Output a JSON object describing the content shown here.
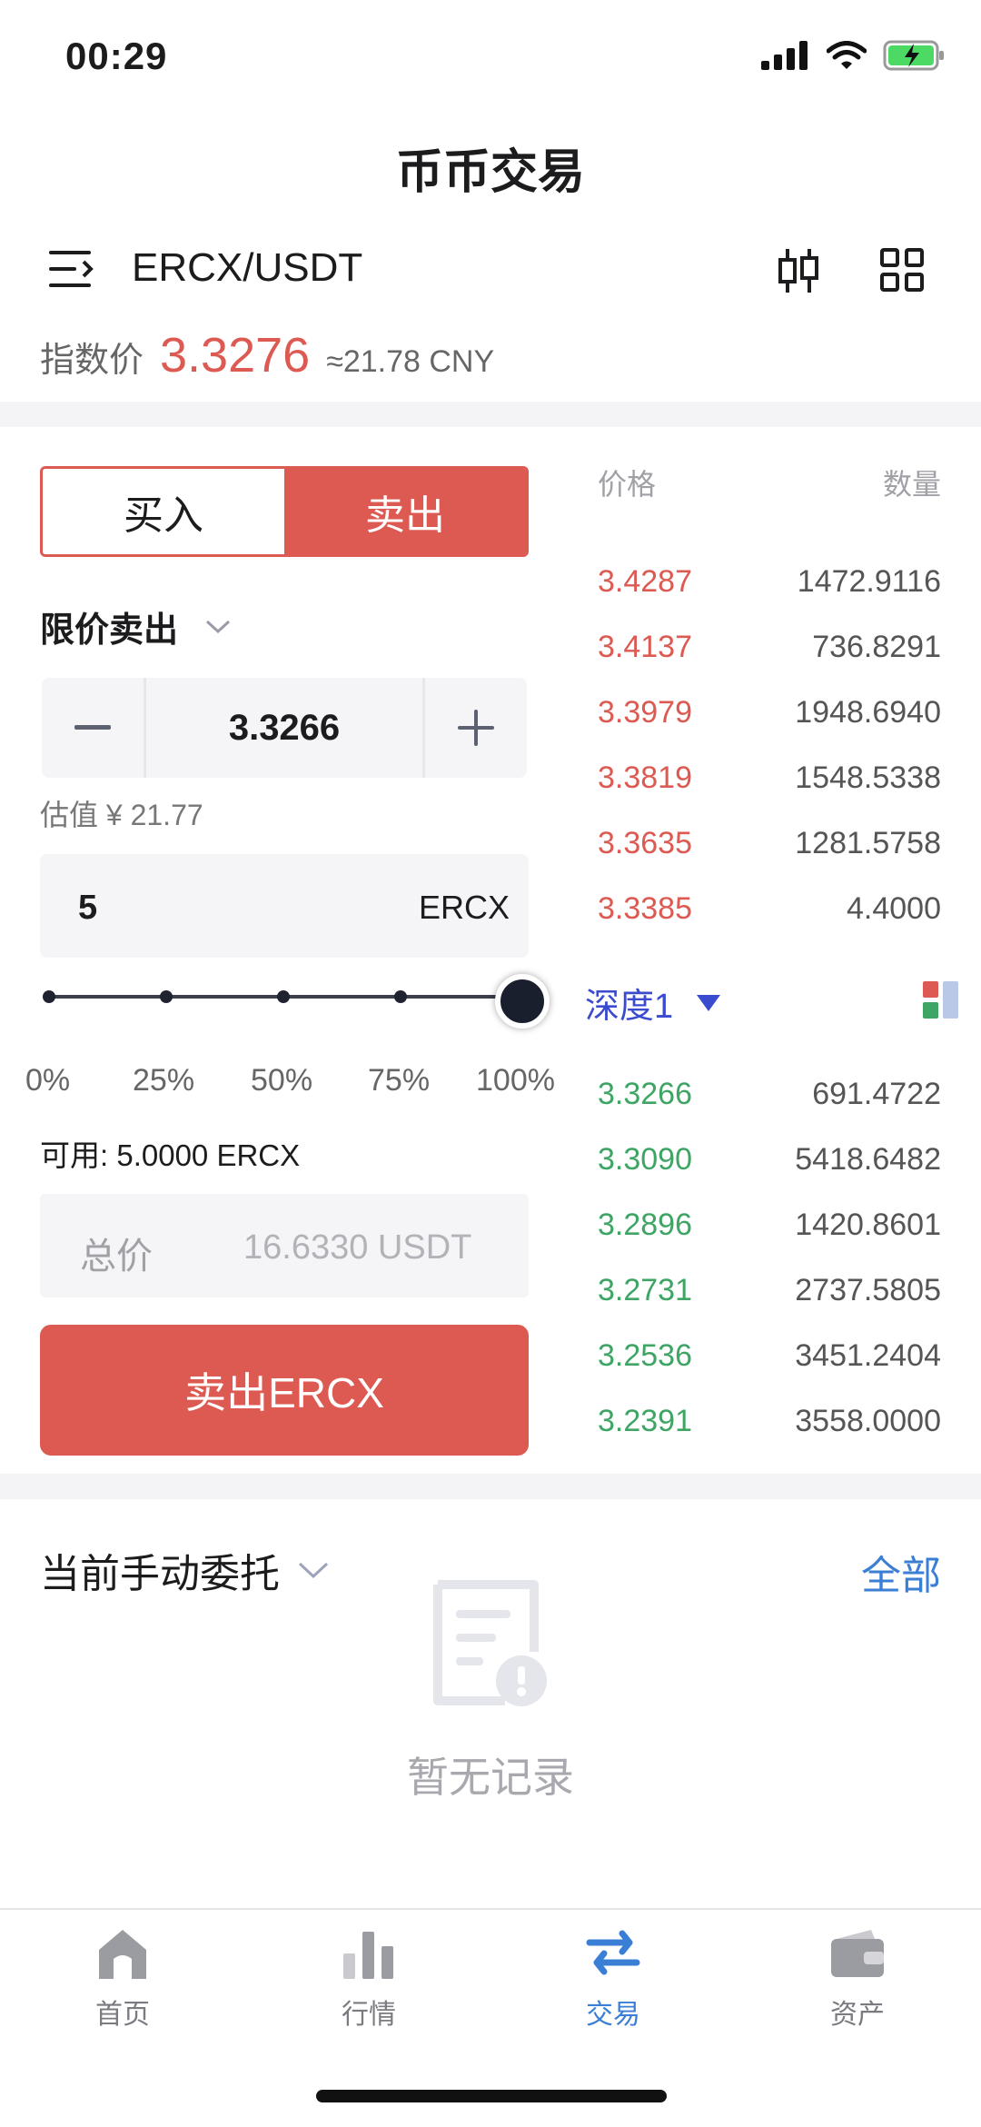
{
  "status": {
    "time": "00:29"
  },
  "header": {
    "title": "币币交易",
    "pair": "ERCX/USDT"
  },
  "index": {
    "label": "指数价",
    "price": "3.3276",
    "cny": "≈21.78 CNY"
  },
  "trade": {
    "buy_label": "买入",
    "sell_label": "卖出",
    "order_type": "限价卖出",
    "price": "3.3266",
    "estimate": "估值 ¥ 21.77",
    "quantity": "5",
    "quantity_unit": "ERCX",
    "slider_percent": 100,
    "percents": [
      "0%",
      "25%",
      "50%",
      "75%",
      "100%"
    ],
    "available": "可用:  5.0000 ERCX",
    "total_label": "总价",
    "total_value": "16.6330 USDT",
    "submit_label": "卖出ERCX"
  },
  "orderbook": {
    "price_header": "价格",
    "qty_header": "数量",
    "asks": [
      {
        "price": "3.4287",
        "qty": "1472.9116"
      },
      {
        "price": "3.4137",
        "qty": "736.8291"
      },
      {
        "price": "3.3979",
        "qty": "1948.6940"
      },
      {
        "price": "3.3819",
        "qty": "1548.5338"
      },
      {
        "price": "3.3635",
        "qty": "1281.5758"
      },
      {
        "price": "3.3385",
        "qty": "4.4000"
      }
    ],
    "depth_label": "深度1",
    "bids": [
      {
        "price": "3.3266",
        "qty": "691.4722"
      },
      {
        "price": "3.3090",
        "qty": "5418.6482"
      },
      {
        "price": "3.2896",
        "qty": "1420.8601"
      },
      {
        "price": "3.2731",
        "qty": "2737.5805"
      },
      {
        "price": "3.2536",
        "qty": "3451.2404"
      },
      {
        "price": "3.2391",
        "qty": "3558.0000"
      }
    ]
  },
  "orders": {
    "title": "当前手动委托",
    "all_label": "全部",
    "empty_text": "暂无记录"
  },
  "tabs": [
    {
      "label": "首页",
      "icon": "home-icon"
    },
    {
      "label": "行情",
      "icon": "bar-chart-icon"
    },
    {
      "label": "交易",
      "icon": "swap-icon"
    },
    {
      "label": "资产",
      "icon": "wallet-icon"
    }
  ],
  "colors": {
    "sell": "#dd5a52",
    "buy": "#3fa564",
    "accent": "#3a7fd5"
  }
}
